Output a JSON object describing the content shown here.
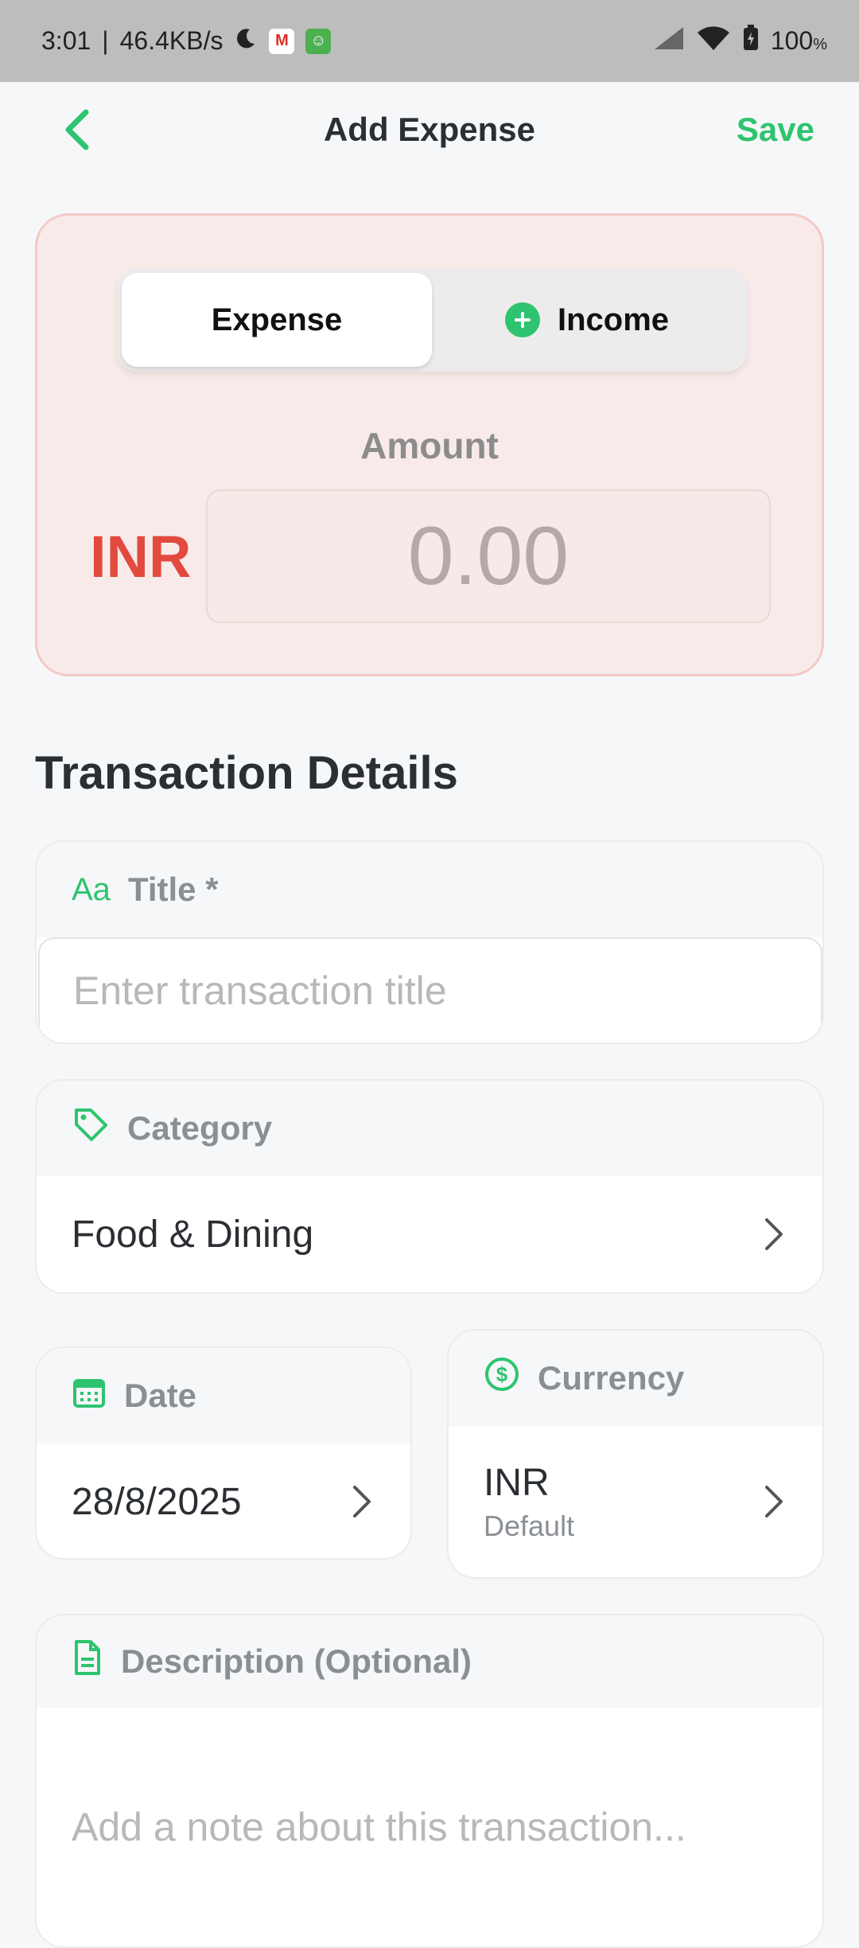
{
  "status_bar": {
    "time": "3:01",
    "network_speed": "46.4KB/s",
    "battery": "100"
  },
  "header": {
    "title": "Add Expense",
    "save_label": "Save"
  },
  "type_toggle": {
    "expense_label": "Expense",
    "income_label": "Income",
    "selected": "Expense"
  },
  "amount": {
    "label": "Amount",
    "currency": "INR",
    "placeholder": "0.00"
  },
  "details": {
    "section_title": "Transaction Details",
    "title_field": {
      "label": "Title *",
      "icon_text": "Aa",
      "placeholder": "Enter transaction title"
    },
    "category_field": {
      "label": "Category",
      "value": "Food & Dining"
    },
    "date_field": {
      "label": "Date",
      "value": "28/8/2025"
    },
    "currency_field": {
      "label": "Currency",
      "value": "INR",
      "sub": "Default"
    },
    "description_field": {
      "label": "Description (Optional)",
      "placeholder": "Add a note about this transaction..."
    }
  },
  "colors": {
    "accent": "#2ec46f",
    "expense_red": "#e24a3e",
    "card_bg": "#f8eae9"
  }
}
